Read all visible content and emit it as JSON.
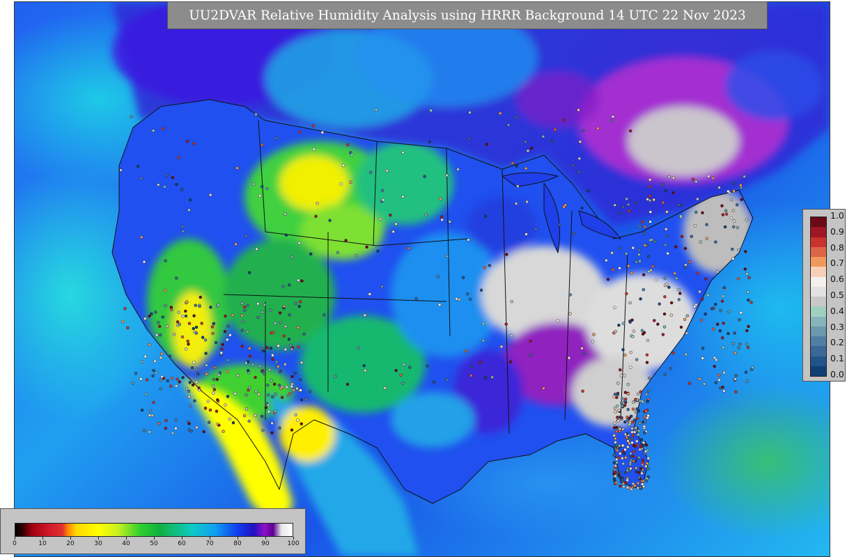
{
  "title": "UU2DVAR Relative Humidity Analysis using HRRR Background 14 UTC 22 Nov 2023",
  "obs_legend": {
    "ticks": [
      "1.0",
      "0.9",
      "0.8",
      "0.7",
      "0.6",
      "0.5",
      "0.4",
      "0.3",
      "0.2",
      "0.1",
      "0.0"
    ],
    "colors": [
      "#6b0a16",
      "#a01624",
      "#c8332f",
      "#dd6447",
      "#ef9a5c",
      "#f7d0b8",
      "#f3f0ed",
      "#e2e2e2",
      "#c8c8c8",
      "#9fcfbf",
      "#86b4b8",
      "#6a98ad",
      "#507fa3",
      "#3a6897",
      "#215488",
      "#0f3f73"
    ]
  },
  "rh_legend": {
    "ticks": [
      "0",
      "10",
      "20",
      "30",
      "40",
      "50",
      "60",
      "70",
      "80",
      "90",
      "100"
    ]
  },
  "colors": {
    "ocean_cyan": "#1fb8f0",
    "deep_blue": "#1a3ff0",
    "purple": "#9010c8",
    "green": "#20c040",
    "yellow": "#ffff00",
    "gray_white": "#d0d0d0",
    "title_bg": "#8c8c8c",
    "legend_bg": "#c4c4c4"
  }
}
